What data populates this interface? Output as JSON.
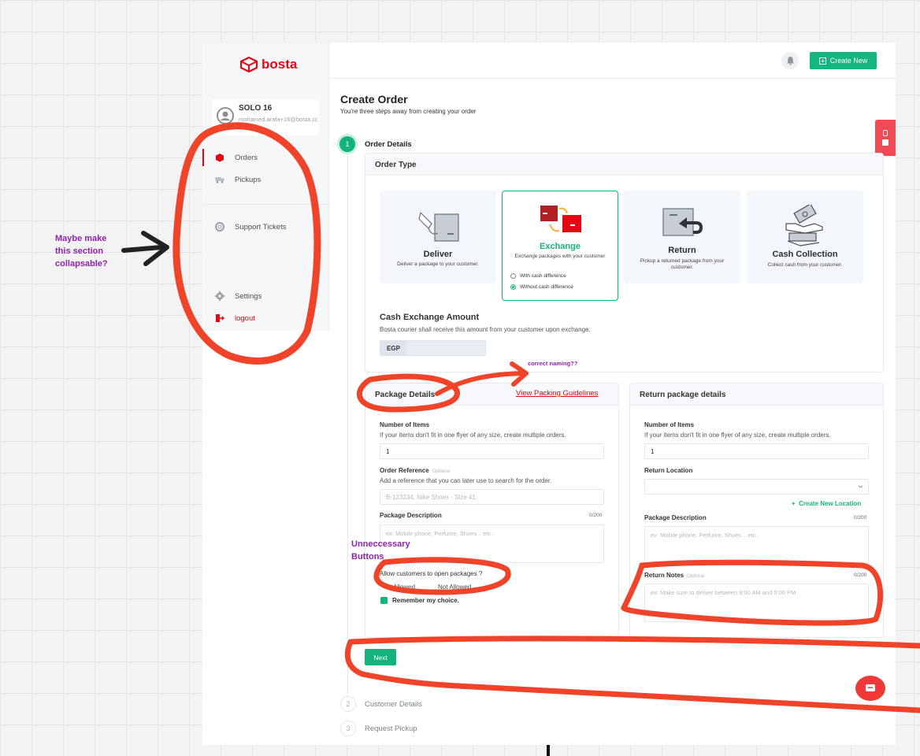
{
  "app": {
    "brand": "bosta",
    "brand_color": "#e30613",
    "accent_color": "#14b27c"
  },
  "profile": {
    "name": "SOLO 16",
    "email": "mohamed.arafa+16@bosta.co"
  },
  "sidebar": {
    "items": [
      {
        "label": "Orders",
        "icon": "box-icon",
        "active": true
      },
      {
        "label": "Pickups",
        "icon": "truck-icon"
      },
      {
        "label": "Support Tickets",
        "icon": "lifebuoy-icon"
      },
      {
        "label": "Settings",
        "icon": "gear-icon"
      },
      {
        "label": "logout",
        "icon": "logout-icon"
      }
    ]
  },
  "topbar": {
    "create_label": "Create New"
  },
  "page": {
    "title": "Create Order",
    "subtitle": "You're three steps away from creating your order"
  },
  "steps": [
    {
      "number": "1",
      "label": "Order Details",
      "active": true
    },
    {
      "number": "2",
      "label": "Customer Details"
    },
    {
      "number": "3",
      "label": "Request Pickup"
    }
  ],
  "order_type": {
    "header": "Order Type",
    "options": [
      {
        "title": "Deliver",
        "desc": "Deliver a package to your customer."
      },
      {
        "title": "Exchange",
        "desc": "Exchange packages with your customer",
        "selected": true,
        "radios": [
          "With cash difference",
          "Without cash difference"
        ],
        "radio_selected": 1
      },
      {
        "title": "Return",
        "desc": "Pickup a returned package from your customer."
      },
      {
        "title": "Cash Collection",
        "desc": "Collect cash from your customer."
      }
    ]
  },
  "cash_exchange": {
    "title": "Cash Exchange Amount",
    "help": "Bosta courier shall receive this amount from your customer upon exchange.",
    "currency": "EGP"
  },
  "package_details": {
    "header": "Package Details",
    "guidelines_link": "View Packing Guidelines",
    "items_label": "Number of Items",
    "items_help": "If your items don't fit in one flyer of any size, create multiple orders.",
    "items_value": "1",
    "ref_label": "Order Reference",
    "optional": "Optional",
    "ref_help": "Add a reference that you can later use to search for the order.",
    "ref_placeholder": "B-123234, Nike Shoes - Size 41.",
    "desc_label": "Package Description",
    "desc_counter": "0/200",
    "desc_placeholder": "ex: Mobile phone, Perfume, Shoes .. etc.",
    "open_label": "Allow customers to open packages ?",
    "open_options": [
      "Allowed",
      "Not Allowed"
    ],
    "remember": "Remember my choice."
  },
  "return_details": {
    "header": "Return package details",
    "items_label": "Number of Items",
    "items_help": "If your items don't fit in one flyer of any size, create multiple orders.",
    "items_value": "1",
    "location_label": "Return Location",
    "new_location": "Create New Location",
    "desc_label": "Package Description",
    "desc_counter": "0/200",
    "desc_placeholder": "ex: Mobile phone, Perfume, Shoes .. etc.",
    "notes_label": "Return Notes",
    "optional": "Optional",
    "notes_counter": "0/200",
    "notes_placeholder": "ex: Make sure to deliver between 9:00 AM and 5:00 PM"
  },
  "next_label": "Next",
  "annotations": {
    "collapse_note": [
      "Maybe make",
      "this section",
      "collapsable?"
    ],
    "naming_note": "correct naming??",
    "buttons_note": [
      "Unneccessary",
      "Buttons"
    ],
    "annotation_color": "#8e24aa",
    "ink_color": "#f0442a"
  }
}
